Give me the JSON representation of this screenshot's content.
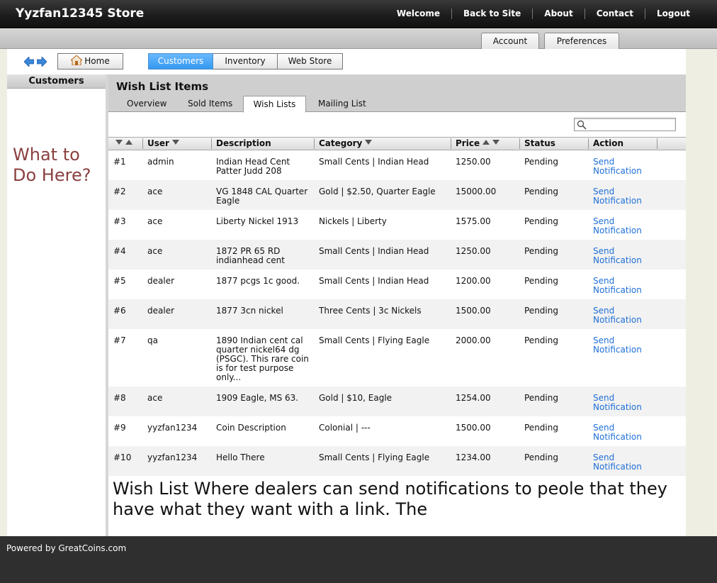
{
  "header": {
    "store_title": "Yyzfan12345 Store",
    "nav": [
      "Welcome",
      "Back to Site",
      "About",
      "Contact",
      "Logout"
    ]
  },
  "subbar": {
    "account": "Account",
    "preferences": "Preferences"
  },
  "toolbar": {
    "home": "Home",
    "sections": [
      "Customers",
      "Inventory",
      "Web Store"
    ],
    "active_section": "Customers"
  },
  "sidebar": {
    "title": "Customers",
    "note": "What to Do Here?"
  },
  "main": {
    "title": "Wish List Items",
    "tabs": [
      "Overview",
      "Sold Items",
      "Wish Lists",
      "Mailing List"
    ],
    "active_tab": "Wish Lists",
    "columns": [
      "User",
      "Description",
      "Category",
      "Price",
      "Status",
      "Action"
    ],
    "rows": [
      {
        "num": "#1",
        "user": "admin",
        "desc": "Indian Head Cent Patter Judd 208",
        "cat": "Small Cents | Indian Head",
        "price": "1250.00",
        "status": "Pending",
        "action": "Send Notification"
      },
      {
        "num": "#2",
        "user": "ace",
        "desc": "VG 1848 CAL Quarter Eagle",
        "cat": "Gold | $2.50, Quarter Eagle",
        "price": "15000.00",
        "status": "Pending",
        "action": "Send Notification"
      },
      {
        "num": "#3",
        "user": "ace",
        "desc": "Liberty Nickel 1913",
        "cat": "Nickels | Liberty",
        "price": "1575.00",
        "status": "Pending",
        "action": "Send Notification"
      },
      {
        "num": "#4",
        "user": "ace",
        "desc": "1872 PR 65 RD indianhead cent",
        "cat": "Small Cents | Indian Head",
        "price": "1250.00",
        "status": "Pending",
        "action": "Send Notification"
      },
      {
        "num": "#5",
        "user": "dealer",
        "desc": "1877 pcgs 1c good.",
        "cat": "Small Cents | Indian Head",
        "price": "1200.00",
        "status": "Pending",
        "action": "Send Notification"
      },
      {
        "num": "#6",
        "user": "dealer",
        "desc": "1877 3cn nickel",
        "cat": "Three Cents | 3c Nickels",
        "price": "1500.00",
        "status": "Pending",
        "action": "Send Notification"
      },
      {
        "num": "#7",
        "user": "qa",
        "desc": "1890 Indian cent cal quarter nickel64 dg (PSGC). This rare coin is for test purpose only...",
        "cat": "Small Cents | Flying Eagle",
        "price": "2000.00",
        "status": "Pending",
        "action": "Send Notification"
      },
      {
        "num": "#8",
        "user": "ace",
        "desc": "1909 Eagle, MS 63.",
        "cat": "Gold | $10, Eagle",
        "price": "1254.00",
        "status": "Pending",
        "action": "Send Notification"
      },
      {
        "num": "#9",
        "user": "yyzfan1234",
        "desc": "Coin Description",
        "cat": "Colonial | ---",
        "price": "1500.00",
        "status": "Pending",
        "action": "Send Notification"
      },
      {
        "num": "#10",
        "user": "yyzfan1234",
        "desc": "Hello There",
        "cat": "Small Cents | Flying Eagle",
        "price": "1234.00",
        "status": "Pending",
        "action": "Send Notification"
      }
    ],
    "note": "Wish List Where dealers can send notifications to peole that they have what they want with a link. The"
  },
  "footer": {
    "text": "Powered by GreatCoins.com"
  },
  "colors": {
    "active_tab": "#3399f0",
    "link": "#1f6fd6",
    "note_left": "#8b4040"
  }
}
